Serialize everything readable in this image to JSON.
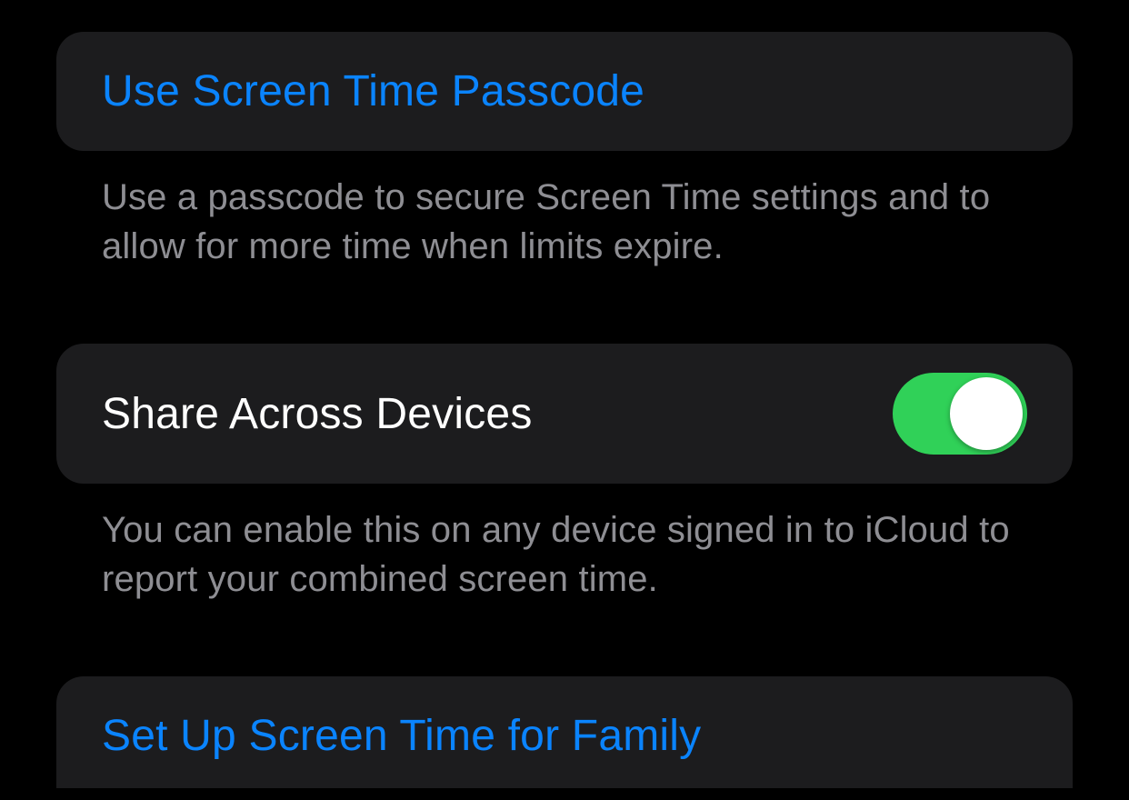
{
  "colors": {
    "link": "#0a84ff",
    "toggleOn": "#30d158",
    "cellBg": "#1c1c1e",
    "footerText": "#8e8e93"
  },
  "groups": {
    "passcode": {
      "label": "Use Screen Time Passcode",
      "footer": "Use a passcode to secure Screen Time settings and to allow for more time when limits expire."
    },
    "share": {
      "label": "Share Across Devices",
      "enabled": true,
      "footer": "You can enable this on any device signed in to iCloud to report your combined screen time."
    },
    "family": {
      "label": "Set Up Screen Time for Family"
    }
  }
}
